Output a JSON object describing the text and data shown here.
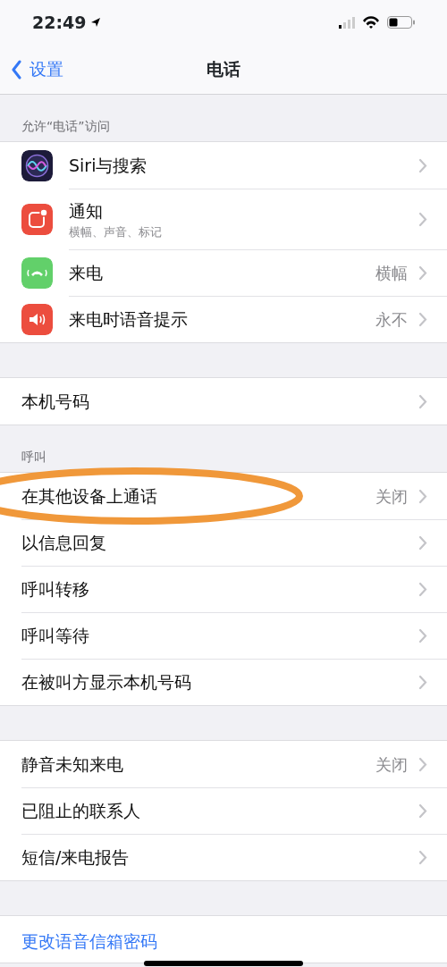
{
  "status_bar": {
    "time": "22:49"
  },
  "nav": {
    "back": "设置",
    "title": "电话"
  },
  "sections": [
    {
      "header": "允许“电话”访问",
      "rows": [
        {
          "label": "Siri与搜索"
        },
        {
          "label": "通知",
          "subtitle": "横幅、声音、标记"
        },
        {
          "label": "来电",
          "value": "横幅"
        },
        {
          "label": "来电时语音提示",
          "value": "永不"
        }
      ]
    },
    {
      "rows": [
        {
          "label": "本机号码"
        }
      ]
    },
    {
      "header": "呼叫",
      "rows": [
        {
          "label": "在其他设备上通话",
          "value": "关闭",
          "highlighted": true
        },
        {
          "label": "以信息回复"
        },
        {
          "label": "呼叫转移"
        },
        {
          "label": "呼叫等待"
        },
        {
          "label": "在被叫方显示本机号码"
        }
      ]
    },
    {
      "rows": [
        {
          "label": "静音未知来电",
          "value": "关闭"
        },
        {
          "label": "已阻止的联系人"
        },
        {
          "label": "短信/来电报告"
        }
      ]
    },
    {
      "rows": [
        {
          "label": "更改语音信箱密码",
          "kind": "link"
        }
      ]
    }
  ]
}
